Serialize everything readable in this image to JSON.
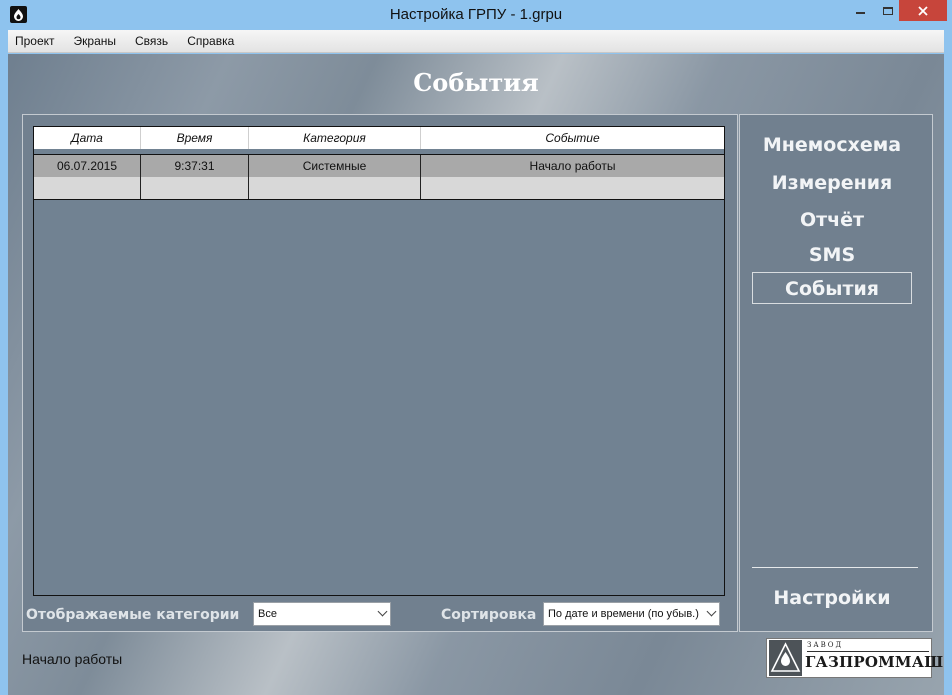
{
  "window": {
    "title": "Настройка ГРПУ - 1.grpu"
  },
  "menu": [
    "Проект",
    "Экраны",
    "Связь",
    "Справка"
  ],
  "page_title": "События",
  "table": {
    "columns": [
      "Дата",
      "Время",
      "Категория",
      "Событие"
    ],
    "rows": [
      {
        "date": "06.07.2015",
        "time": "9:37:31",
        "category": "Системные",
        "event": "Начало работы"
      }
    ]
  },
  "filters": {
    "categories_label": "Отображаемые категории",
    "categories_value": "Все",
    "sort_label": "Сортировка",
    "sort_value": "По дате и времени (по убыв.)"
  },
  "nav": {
    "items": [
      "Мнемосхема",
      "Измерения",
      "Отчёт",
      "SMS",
      "События"
    ],
    "active": "События",
    "settings": "Настройки"
  },
  "status": "Начало работы",
  "logo": {
    "small_text": "ЗАВОД",
    "name": "ГАЗПРОММАШ"
  },
  "colors": {
    "titlebar": "#8ec3ee",
    "close_button": "#c7453b",
    "panel": "#71808f",
    "row_selected": "#a9a9a9"
  }
}
